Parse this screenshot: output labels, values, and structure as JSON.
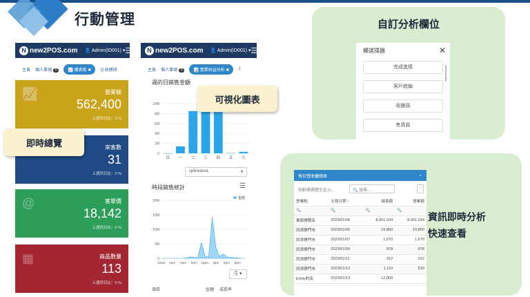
{
  "heading": "行動管理",
  "phone1": {
    "logo": "new2POS.com",
    "user": "Admin(ID001)",
    "tabs": [
      "主頁",
      "個人事項",
      "儀表板",
      "Q 收總排"
    ],
    "tab_badge": "0",
    "cards": [
      {
        "title": "營業額",
        "value": "562,400",
        "sub": "上週同日比：0 %",
        "color": "#c9a31a",
        "icon": "trend-up-icon"
      },
      {
        "title": "來客數",
        "value": "31",
        "sub": "上週同日比：0 %",
        "color": "#1f4a84",
        "icon": "people-icon"
      },
      {
        "title": "客單價",
        "value": "18,142",
        "sub": "上週同日比：0 %",
        "color": "#2e9e5b",
        "icon": "at-icon"
      },
      {
        "title": "商品數量",
        "value": "113",
        "sub": "上週同日比：0 %",
        "color": "#a32632",
        "icon": "boxes-icon"
      }
    ]
  },
  "phone2": {
    "logo": "new2POS.com",
    "user": "Admin(ID001)",
    "tabs": [
      "主頁",
      "個人事項",
      "營業收益分析",
      "1"
    ],
    "tab_badge": "0",
    "chart1_title": "週的日銷售金額",
    "select_value": "splinearea",
    "chart2_title": "時段銷售統計",
    "chart2_legend": "金額",
    "table_cols": [
      "項目",
      "金額",
      "成長率"
    ]
  },
  "chart_data": [
    {
      "type": "bar",
      "title": "週的日銷售金額",
      "categories": [
        "日",
        "一",
        "二",
        "三",
        "四",
        "五",
        "六"
      ],
      "values": [
        0,
        1.4,
        8.5,
        8.4,
        8.3,
        0.05,
        0.3
      ],
      "y_ticks": [
        "0",
        "2M",
        "4M",
        "6M",
        "8M",
        "10M"
      ],
      "ylim": [
        0,
        10
      ],
      "color": "#2aa6e8"
    },
    {
      "type": "area",
      "title": "時段銷售統計",
      "legend": "金額",
      "x_ticks": [
        "12am",
        "3am",
        "6am",
        "9am",
        "12pm",
        "3pm",
        "6pm",
        "9pm"
      ],
      "y_ticks": [
        "0",
        "5M",
        "10M",
        "15M",
        "20M"
      ],
      "ylim": [
        0,
        20
      ],
      "x": [
        0,
        3,
        6,
        7,
        8,
        9,
        10,
        11,
        12,
        13,
        14,
        15,
        16,
        17,
        18,
        19,
        20,
        21,
        22,
        23
      ],
      "values": [
        0,
        0,
        0,
        0.2,
        0.5,
        0.3,
        0.2,
        5.5,
        0.8,
        0.4,
        14.2,
        3.8,
        0.6,
        1.5,
        0.5,
        0.3,
        0.2,
        0.1,
        0,
        0
      ],
      "color": "#7fc8ef"
    }
  ],
  "callouts": {
    "visual": "可視化圖表",
    "realtime": "即時總覽"
  },
  "custom_fields": {
    "title": "自訂分析欄位",
    "selector_title": "欄選擇器",
    "items": [
      "完成進樣",
      "客戶統編",
      "收銀員",
      "售貨員"
    ]
  },
  "report": {
    "panel_title": "資訊即時分析快速查看",
    "panel_title_lines": [
      "資訊即時分析",
      "快速查看"
    ],
    "title": "每日營收彙總表",
    "drag_hint": "拖動欄標題至此以...",
    "search_placeholder": "搜尋...",
    "columns": [
      "營業點",
      "交易日期 ↑",
      "銷售額",
      "營業額"
    ],
    "rows": [
      [
        "黃旗博覽店",
        "2023/01/06",
        "8,001,034",
        "8,001,034"
      ],
      [
        "同濟寮門市",
        "2023/01/06",
        "19,850",
        "19,850"
      ],
      [
        "同濟寮門市",
        "2023/01/07",
        "1,670",
        "1,670"
      ],
      [
        "同濟寮門市",
        "2023/01/09",
        "878",
        "878"
      ],
      [
        "同濟寮門市",
        "2023/01/11",
        "312",
        "312"
      ],
      [
        "同濟寮門市",
        "2023/01/12",
        "1,110",
        "510"
      ],
      [
        "Emily的店",
        "2023/01/13",
        "12,800",
        ""
      ]
    ]
  }
}
